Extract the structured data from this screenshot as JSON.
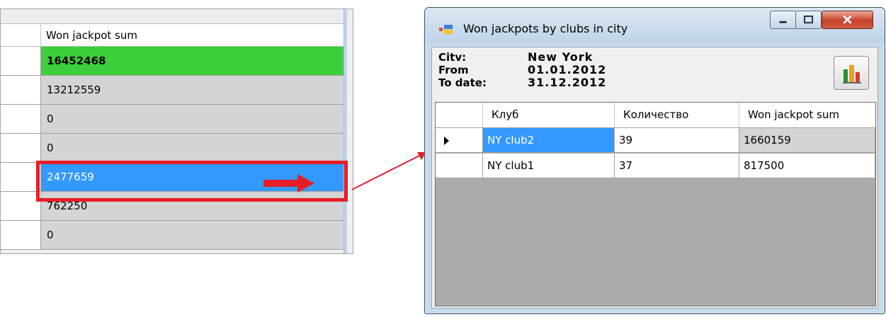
{
  "left_grid": {
    "column_header": "Won jackpot sum",
    "rows": [
      {
        "value": "16452468",
        "state": "highlighted"
      },
      {
        "value": "13212559",
        "state": "normal"
      },
      {
        "value": "0",
        "state": "normal"
      },
      {
        "value": "0",
        "state": "normal"
      },
      {
        "value": "2477659",
        "state": "selected"
      },
      {
        "value": "762250",
        "state": "normal"
      },
      {
        "value": "0",
        "state": "normal"
      }
    ],
    "ellipsis_button_label": "..",
    "annotation_color": "#e61e28"
  },
  "window": {
    "title": "Won jackpots by clubs in city",
    "info": {
      "city_label": "Citv:",
      "city_value": "New York",
      "from_label": "From",
      "from_value": "01.01.2012",
      "to_label": "To date:",
      "to_value": "31.12.2012"
    },
    "chart_button_icon": "bar-chart-icon",
    "grid": {
      "columns": [
        "Клуб",
        "Количество",
        "Won jackpot sum"
      ],
      "rows": [
        {
          "club": "NY club2",
          "count": "39",
          "sum": "1660159",
          "current": true
        },
        {
          "club": "NY club1",
          "count": "37",
          "sum": "817500",
          "current": false
        }
      ]
    }
  },
  "colors": {
    "highlight_green": "#3ccf3c",
    "selection_blue": "#3399ff",
    "arrow_red": "#e61e28"
  }
}
